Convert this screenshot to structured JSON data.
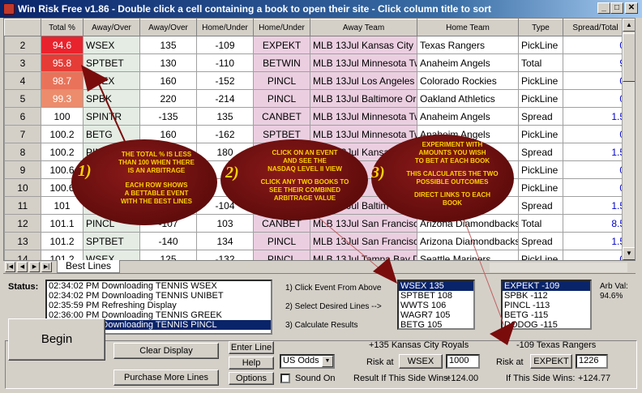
{
  "window": {
    "title": "Win Risk Free v1.86 - Double click a cell containing a book to open their site - Click column title to sort",
    "min": "_",
    "max": "□",
    "close": "✕"
  },
  "grid": {
    "columns": [
      "Total %",
      "Away/Over",
      "Away/Over",
      "Home/Under",
      "Home/Under",
      "Away Team",
      "Home Team",
      "Type",
      "Spread/Total"
    ],
    "rows": [
      {
        "n": "2",
        "total": "94.6",
        "ab": "WSEX",
        "ao": "135",
        "hu": "-109",
        "hb": "EXPEKT",
        "away": "MLB 13Jul Kansas City R",
        "home": "Texas Rangers",
        "type": "PickLine",
        "st": "0",
        "bg": "#e8232d",
        "fg": "#ffffff"
      },
      {
        "n": "3",
        "total": "95.8",
        "ab": "SPTBET",
        "ao": "130",
        "hu": "-110",
        "hb": "BETWIN",
        "away": "MLB 13Jul Minnesota Tw",
        "home": "Anaheim Angels",
        "type": "Total",
        "st": "9",
        "bg": "#e53c37",
        "fg": "#ffffff"
      },
      {
        "n": "4",
        "total": "98.7",
        "ab": "WSEX",
        "ao": "160",
        "hu": "-152",
        "hb": "PINCL",
        "away": "MLB 13Jul Los Angeles D",
        "home": "Colorado Rockies",
        "type": "PickLine",
        "st": "0",
        "bg": "#e8735a",
        "fg": "#ffffff"
      },
      {
        "n": "5",
        "total": "99.3",
        "ab": "SPBK",
        "ao": "220",
        "hu": "-214",
        "hb": "PINCL",
        "away": "MLB 13Jul Baltimore Oric",
        "home": "Oakland Athletics",
        "type": "PickLine",
        "st": "0",
        "bg": "#ec8c6c",
        "fg": "#ffffff"
      },
      {
        "n": "6",
        "total": "100",
        "ab": "SPINTR",
        "ao": "-135",
        "hu": "135",
        "hb": "CANBET",
        "away": "MLB 13Jul Minnesota Tw",
        "home": "Anaheim Angels",
        "type": "Spread",
        "st": "1.5",
        "bg": "#ffffff",
        "fg": "#000000"
      },
      {
        "n": "7",
        "total": "100.2",
        "ab": "BETG",
        "ao": "160",
        "hu": "-162",
        "hb": "SPTBET",
        "away": "MLB 13Jul Minnesota Tw",
        "home": "Anaheim Angels",
        "type": "PickLine",
        "st": "0",
        "bg": "#ffffff",
        "fg": "#000000"
      },
      {
        "n": "8",
        "total": "100.2",
        "ab": "PIN",
        "ao": "",
        "hu": "180",
        "hb": "",
        "away": "MLB 13Jul Kansas",
        "home": "Texas Rangers",
        "type": "Spread",
        "st": "1.5",
        "bg": "#ffffff",
        "fg": "#000000"
      },
      {
        "n": "9",
        "total": "100.6",
        "ab": "",
        "ao": "",
        "hu": "",
        "hb": "",
        "away": "",
        "home": "",
        "type": "PickLine",
        "st": "0",
        "bg": "#ffffff",
        "fg": "#000000"
      },
      {
        "n": "10",
        "total": "100.6",
        "ab": "",
        "ao": "",
        "hu": "",
        "hb": "",
        "away": "",
        "home": "",
        "type": "PickLine",
        "st": "0",
        "bg": "#ffffff",
        "fg": "#000000"
      },
      {
        "n": "11",
        "total": "101",
        "ab": "W",
        "ao": "",
        "hu": "-104",
        "hb": "",
        "away": "MLB 13Jul Baltim",
        "home": "",
        "type": "Spread",
        "st": "1.5",
        "bg": "#ffffff",
        "fg": "#000000"
      },
      {
        "n": "12",
        "total": "101.1",
        "ab": "PINCL",
        "ao": "-107",
        "hu": "103",
        "hb": "CANBET",
        "away": "MLB 13Jul San Francisco",
        "home": "Arizona Diamondbacks",
        "type": "Total",
        "st": "8.5",
        "bg": "#ffffff",
        "fg": "#000000"
      },
      {
        "n": "13",
        "total": "101.2",
        "ab": "SPTBET",
        "ao": "-140",
        "hu": "134",
        "hb": "PINCL",
        "away": "MLB 13Jul San Francisco",
        "home": "Arizona Diamondbacks",
        "type": "Spread",
        "st": "1.5",
        "bg": "#ffffff",
        "fg": "#000000"
      },
      {
        "n": "14",
        "total": "101.2",
        "ab": "WSEX",
        "ao": "125",
        "hu": "-132",
        "hb": "PINCL",
        "away": "MLB 13Jul Tampa Bay D",
        "home": "Seattle Mariners",
        "type": "PickLine",
        "st": "0",
        "bg": "#ffffff",
        "fg": "#000000"
      }
    ]
  },
  "tab": {
    "label": "Best Lines"
  },
  "status": {
    "label": "Status:",
    "lines": [
      "02:34:02 PM Downloading TENNIS WSEX",
      "02:34:02 PM Downloading TENNIS UNIBET",
      "02:35:59 PM Refreshing Display",
      "02:36:00 PM Downloading TENNIS GREEK",
      "02:36:00 PM Downloading TENNIS PINCL"
    ]
  },
  "steps": [
    "1) Click Event From Above",
    "2) Select Desired Lines -->",
    "3) Calculate Results"
  ],
  "away_list": [
    "WSEX 135",
    "SPTBET 108",
    "WWTS 106",
    "WAGR7 105",
    "BETG 105"
  ],
  "home_list": [
    "EXPEKT -109",
    "SPBK -112",
    "PINCL -113",
    "BETG -115",
    "DODOG -115"
  ],
  "arb": {
    "label": "Arb Val:",
    "value": "94.6%"
  },
  "controls": {
    "begin": "Begin",
    "clear": "Clear Display",
    "purchase": "Purchase More Lines",
    "enter_line": "Enter Line",
    "help": "Help",
    "options": "Options",
    "odds_select": "US Odds",
    "sound_on": "Sound On"
  },
  "calc": {
    "away_header": "+135 Kansas City Royals",
    "home_header": "-109 Texas Rangers",
    "risk_at": "Risk at",
    "away_book": "WSEX",
    "away_amount": "1000",
    "home_book": "EXPEKT",
    "home_amount": "1226",
    "away_result_label": "Result If This Side Wins:",
    "away_result": "+124.00",
    "home_result_label": "If This Side Wins:",
    "home_result": "+124.77"
  },
  "annotations": {
    "one": {
      "num": "1)",
      "text": [
        "THE TOTAL % IS LESS",
        "THAN 100 WHEN THERE",
        "IS AN ARBITRAGE",
        "",
        "EACH ROW SHOWS",
        "A BETTABLE EVENT",
        "WITH THE BEST LINES"
      ]
    },
    "two": {
      "num": "2)",
      "text": [
        "CLICK ON AN EVENT",
        "AND SEE THE",
        "NASDAQ LEVEL II VIEW",
        "",
        "CLICK ANY TWO BOOKS TO",
        "SEE THEIR  COMBINED",
        "ARBITRAGE VALUE"
      ]
    },
    "three": {
      "num": "3)",
      "text": [
        "EXPERIMENT WITH",
        "AMOUNTS YOU WISH",
        "TO BET AT EACH BOOK",
        "",
        "THIS CALCULATES THE TWO",
        "POSSIBLE OUTCOMES",
        "",
        "DIRECT LINKS TO EACH",
        "BOOK"
      ]
    }
  }
}
